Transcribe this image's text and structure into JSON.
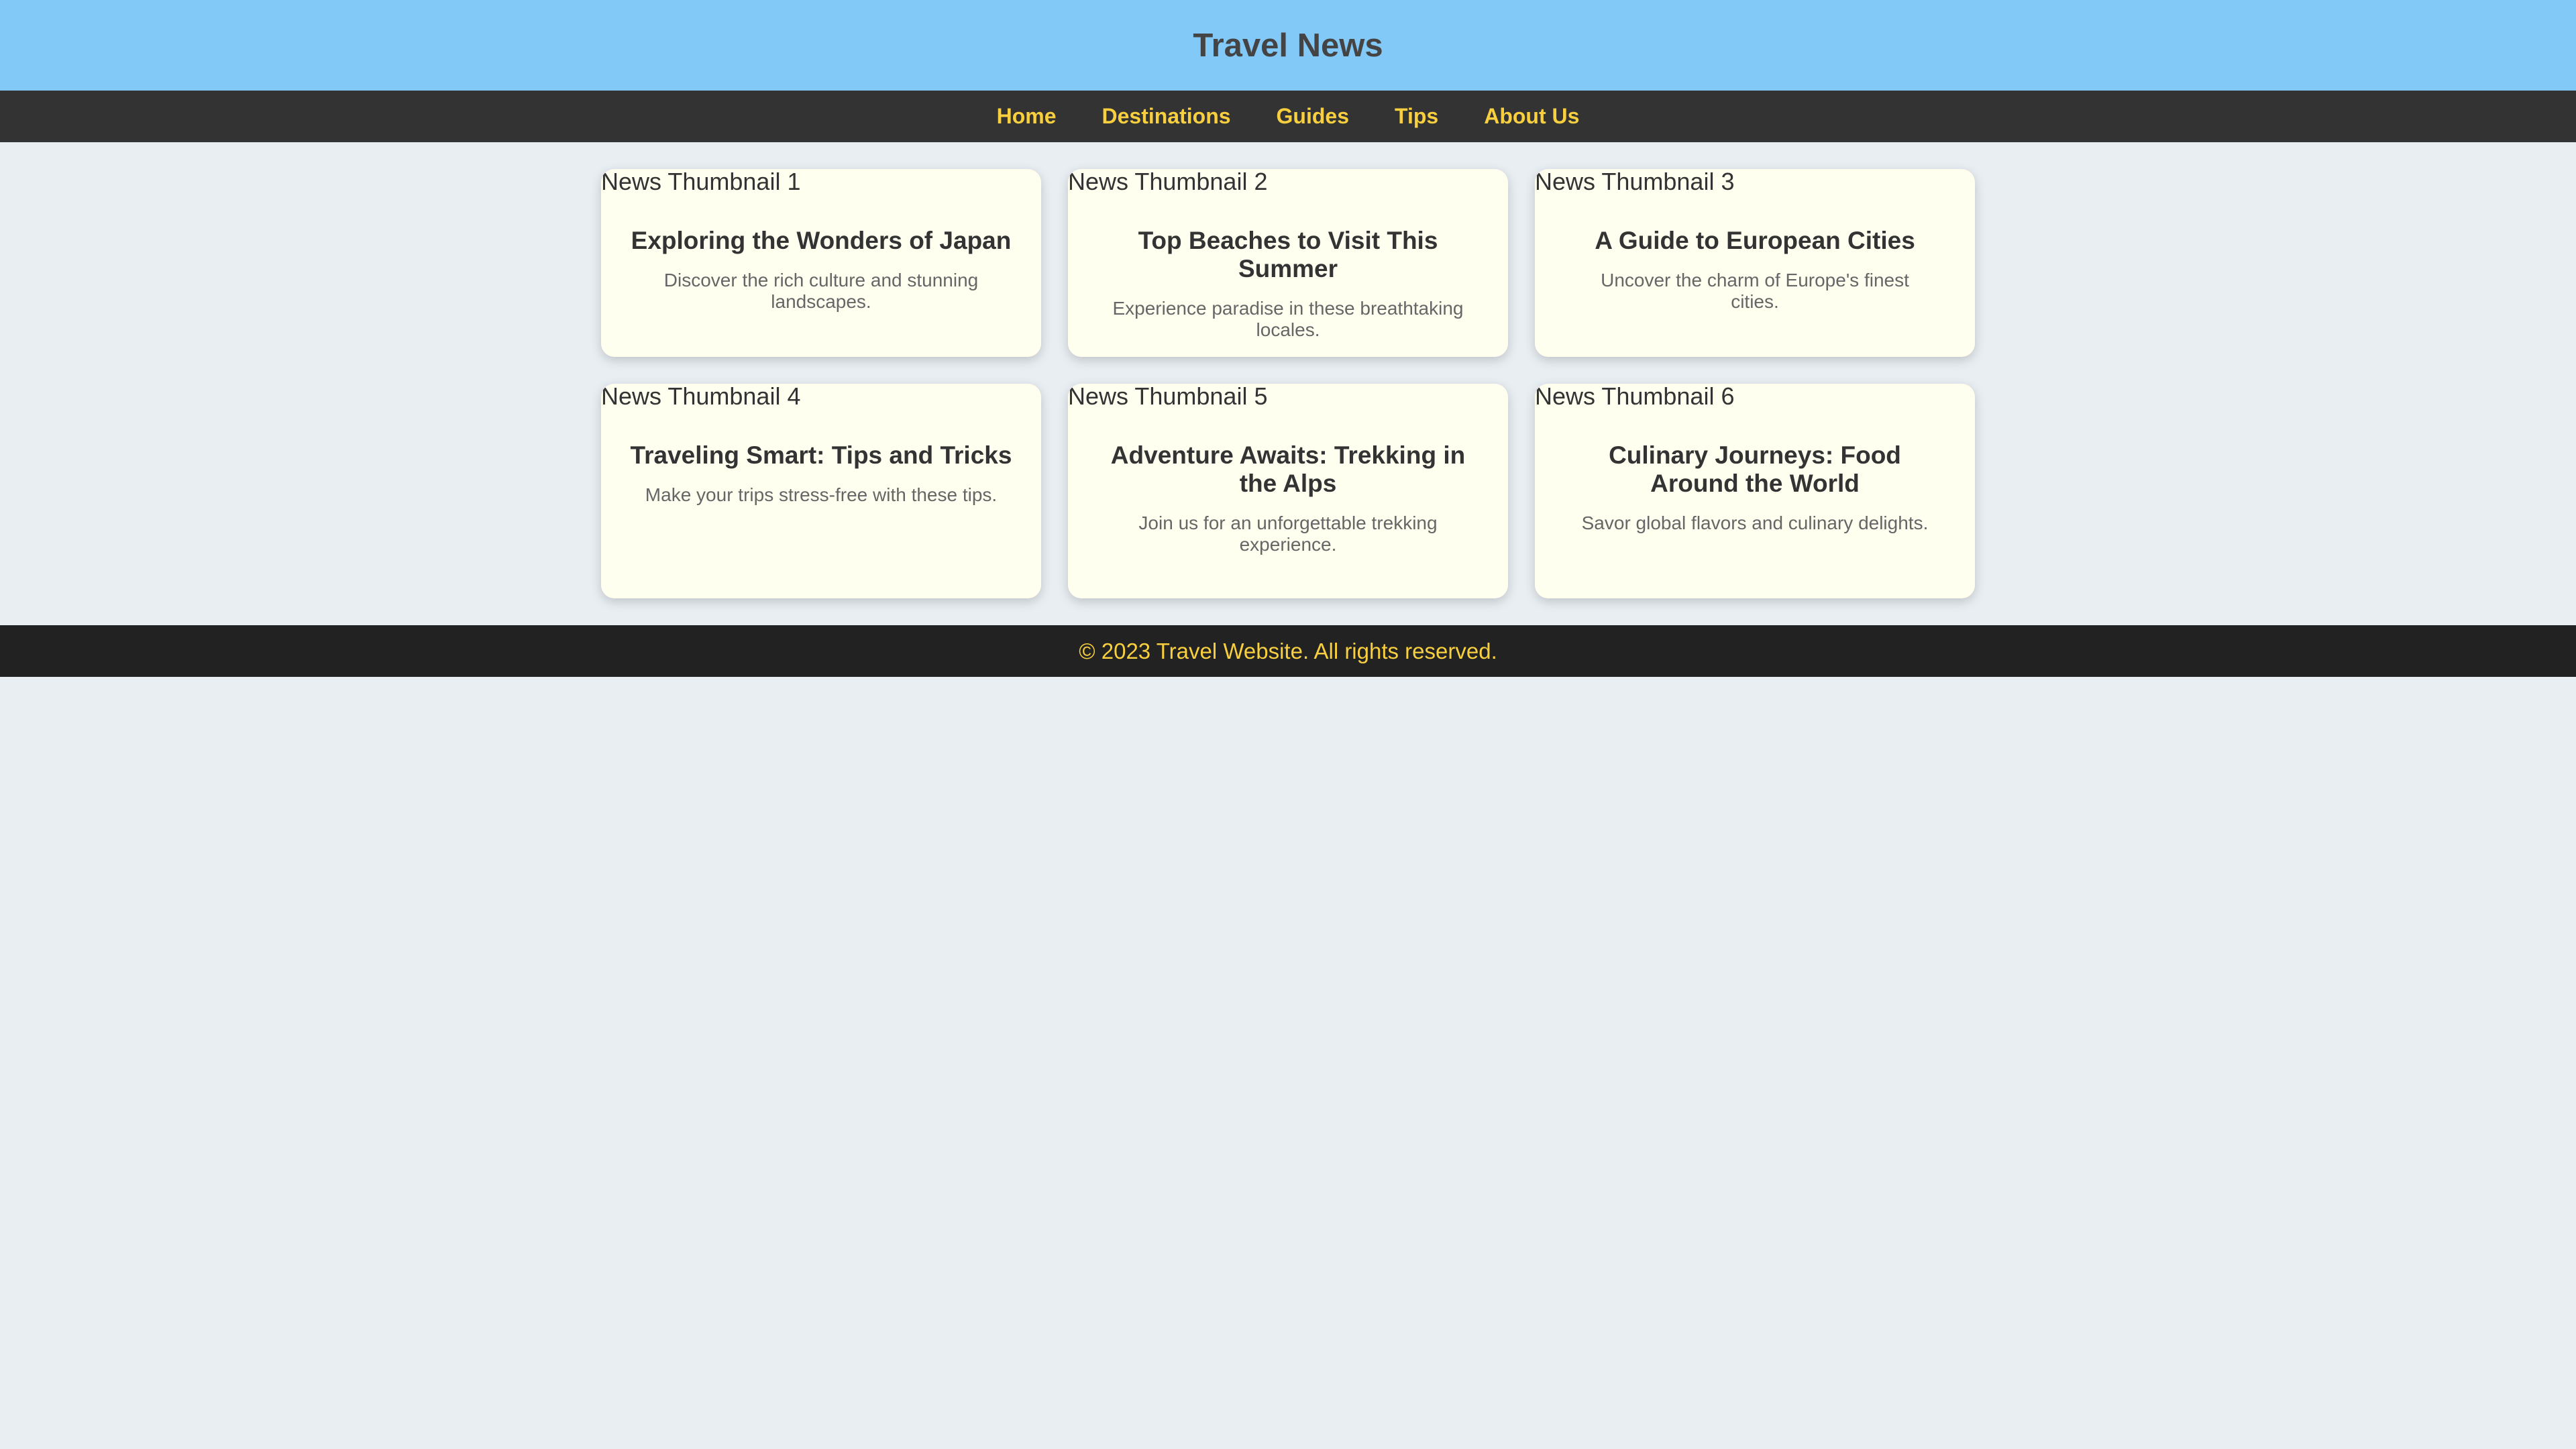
{
  "header": {
    "title": "Travel News"
  },
  "nav": {
    "items": [
      {
        "label": "Home"
      },
      {
        "label": "Destinations"
      },
      {
        "label": "Guides"
      },
      {
        "label": "Tips"
      },
      {
        "label": "About Us"
      }
    ]
  },
  "cards": [
    {
      "thumb_alt": "News Thumbnail 1",
      "title": "Exploring the Wonders of Japan",
      "desc": "Discover the rich culture and stunning landscapes."
    },
    {
      "thumb_alt": "News Thumbnail 2",
      "title": "Top Beaches to Visit This Summer",
      "desc": "Experience paradise in these breathtaking locales."
    },
    {
      "thumb_alt": "News Thumbnail 3",
      "title": "A Guide to European Cities",
      "desc": "Uncover the charm of Europe's finest cities."
    },
    {
      "thumb_alt": "News Thumbnail 4",
      "title": "Traveling Smart: Tips and Tricks",
      "desc": "Make your trips stress-free with these tips."
    },
    {
      "thumb_alt": "News Thumbnail 5",
      "title": "Adventure Awaits: Trekking in the Alps",
      "desc": "Join us for an unforgettable trekking experience."
    },
    {
      "thumb_alt": "News Thumbnail 6",
      "title": "Culinary Journeys: Food Around the World",
      "desc": "Savor global flavors and culinary delights."
    }
  ],
  "footer": {
    "text": "© 2023 Travel Website. All rights reserved."
  },
  "colors": {
    "header_bg": "#82c9f8",
    "nav_bg": "#333333",
    "accent": "#f8cf3f",
    "card_bg": "#fffff0",
    "page_bg": "#e8eef2",
    "footer_bg": "#222222"
  }
}
